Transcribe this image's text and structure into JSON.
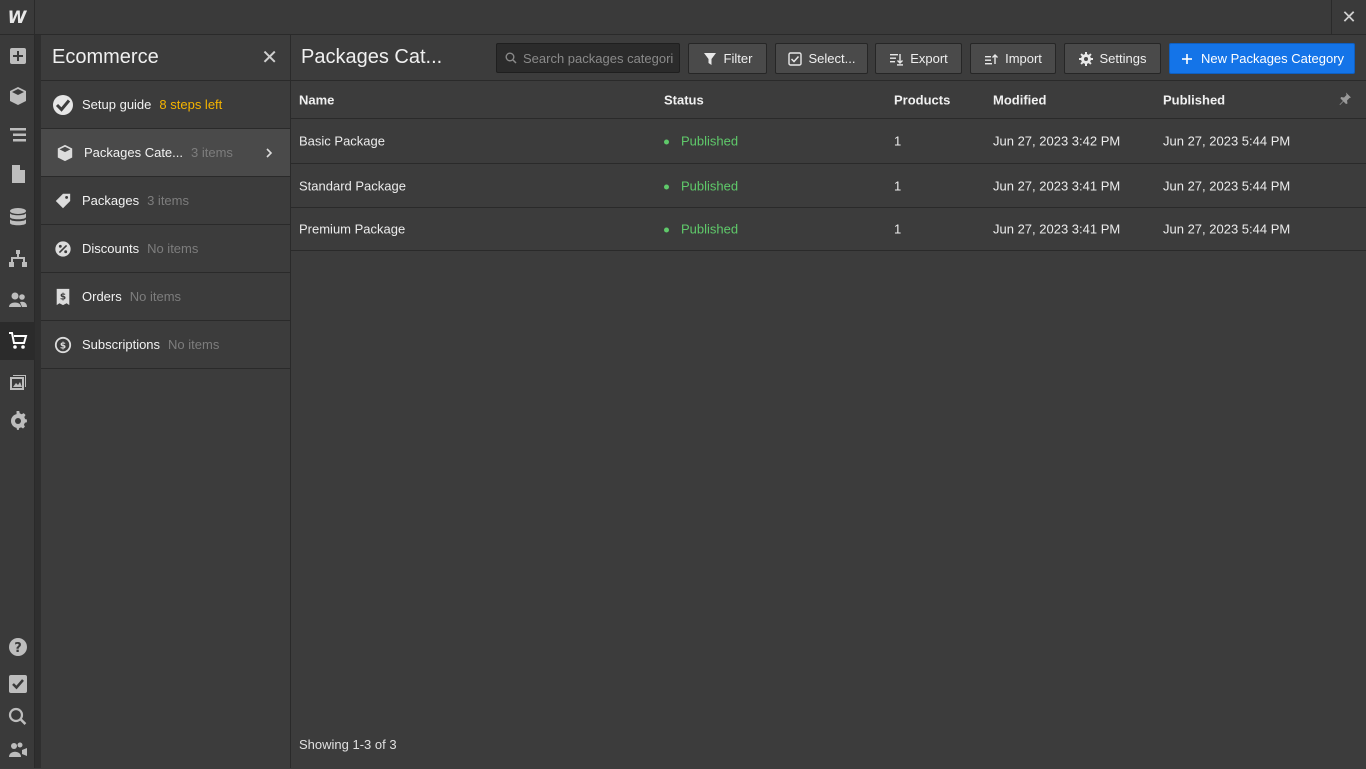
{
  "topbar": {
    "logo": "W",
    "close": "✕"
  },
  "rail": {
    "items": [
      {
        "icon": "plus-icon"
      },
      {
        "icon": "cube-icon"
      },
      {
        "icon": "navigator-icon"
      },
      {
        "icon": "page-icon"
      },
      {
        "icon": "database-icon"
      },
      {
        "icon": "logic-icon"
      },
      {
        "icon": "users-icon"
      },
      {
        "icon": "cart-icon",
        "active": true
      },
      {
        "icon": "assets-icon"
      },
      {
        "icon": "gear-icon"
      },
      {
        "icon": "help-icon"
      },
      {
        "icon": "checkbox-icon"
      },
      {
        "icon": "search-icon"
      },
      {
        "icon": "video-users-icon"
      }
    ]
  },
  "panel": {
    "title": "Ecommerce",
    "close": "✕",
    "items": [
      {
        "label": "Setup guide",
        "meta": "8 steps left"
      },
      {
        "label": "Packages Cate...",
        "meta": "3 items"
      },
      {
        "label": "Packages",
        "meta": "3 items"
      },
      {
        "label": "Discounts",
        "meta": "No items"
      },
      {
        "label": "Orders",
        "meta": "No items"
      },
      {
        "label": "Subscriptions",
        "meta": "No items"
      }
    ]
  },
  "main": {
    "title": "Packages Cat...",
    "search_placeholder": "Search packages categorie",
    "buttons": {
      "filter": "Filter",
      "select": "Select...",
      "export": "Export",
      "import": "Import",
      "settings": "Settings",
      "new": "New Packages Category"
    },
    "columns": {
      "name": "Name",
      "status": "Status",
      "products": "Products",
      "modified": "Modified",
      "published": "Published"
    },
    "rows": [
      {
        "name": "Basic Package",
        "status": "Published",
        "products": "1",
        "modified": "Jun 27, 2023 3:42 PM",
        "published": "Jun 27, 2023 5:44 PM"
      },
      {
        "name": "Standard Package",
        "status": "Published",
        "products": "1",
        "modified": "Jun 27, 2023 3:41 PM",
        "published": "Jun 27, 2023 5:44 PM"
      },
      {
        "name": "Premium Package",
        "status": "Published",
        "products": "1",
        "modified": "Jun 27, 2023 3:41 PM",
        "published": "Jun 27, 2023 5:44 PM"
      }
    ],
    "footer": "Showing 1-3 of 3"
  },
  "colors": {
    "accent": "#1474e8",
    "warning": "#f5b400",
    "success": "#5fc96a",
    "background": "#3c3c3c"
  }
}
